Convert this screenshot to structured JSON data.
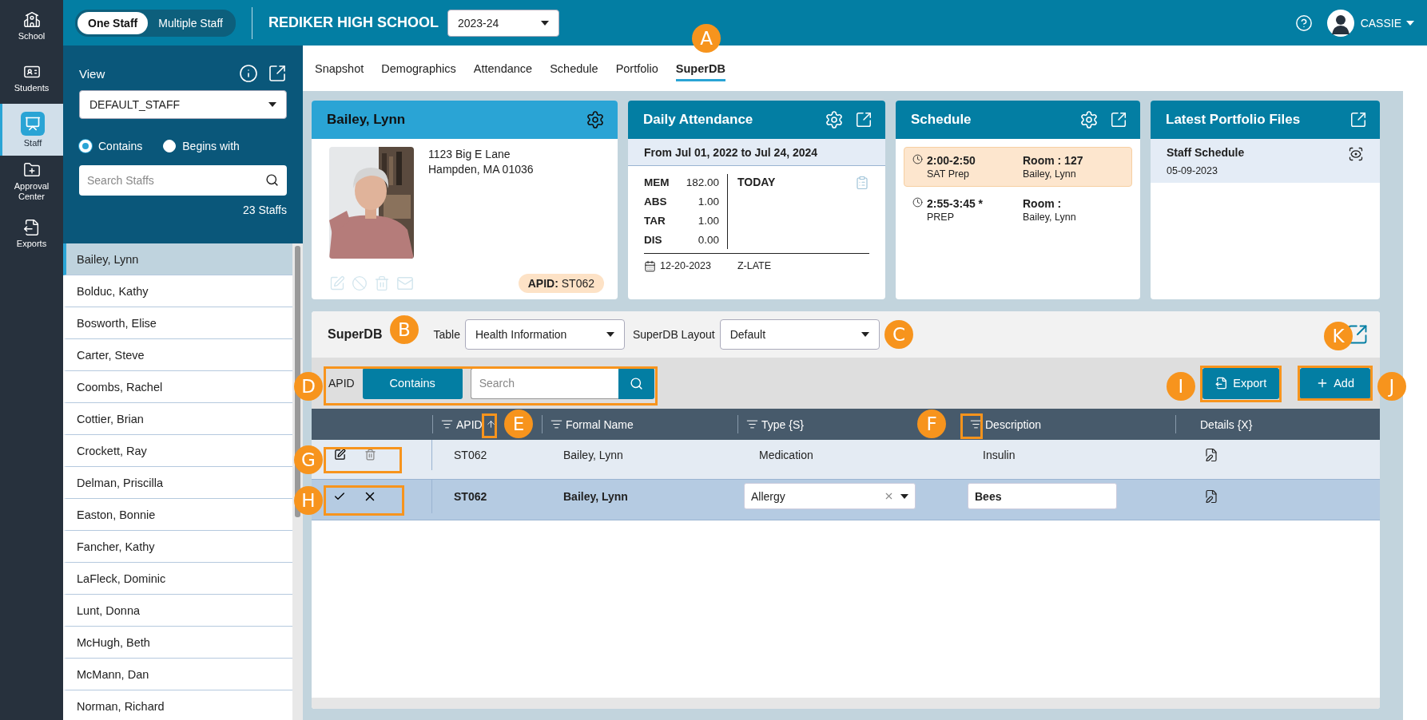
{
  "rail": [
    {
      "label": "School",
      "selected": false
    },
    {
      "label": "Students",
      "selected": false
    },
    {
      "label": "Staff",
      "selected": true
    },
    {
      "label": "Approval Center",
      "selected": false
    },
    {
      "label": "Exports",
      "selected": false
    }
  ],
  "topbar": {
    "modes": [
      {
        "label": "One Staff",
        "selected": true
      },
      {
        "label": "Multiple Staff",
        "selected": false
      }
    ],
    "school": "REDIKER HIGH SCHOOL",
    "year": "2023-24",
    "user": "CASSIE"
  },
  "side": {
    "view_label": "View",
    "view": "DEFAULT_STAFF",
    "match": [
      {
        "label": "Contains",
        "selected": true
      },
      {
        "label": "Begins with",
        "selected": false
      }
    ],
    "search_placeholder": "Search Staffs",
    "count": "23 Staffs",
    "staff": [
      {
        "name": "Bailey, Lynn",
        "selected": true
      },
      {
        "name": "Bolduc, Kathy",
        "selected": false
      },
      {
        "name": "Bosworth, Elise",
        "selected": false
      },
      {
        "name": "Carter, Steve",
        "selected": false
      },
      {
        "name": "Coombs, Rachel",
        "selected": false
      },
      {
        "name": "Cottier, Brian",
        "selected": false
      },
      {
        "name": "Crockett, Ray",
        "selected": false
      },
      {
        "name": "Delman, Priscilla",
        "selected": false
      },
      {
        "name": "Easton, Bonnie",
        "selected": false
      },
      {
        "name": "Fancher, Kathy",
        "selected": false
      },
      {
        "name": "LaFleck, Dominic",
        "selected": false
      },
      {
        "name": "Lunt, Donna",
        "selected": false
      },
      {
        "name": "McHugh, Beth",
        "selected": false
      },
      {
        "name": "McMann, Dan",
        "selected": false
      },
      {
        "name": "Norman, Richard",
        "selected": false
      }
    ]
  },
  "tabs": [
    {
      "label": "Snapshot",
      "selected": false
    },
    {
      "label": "Demographics",
      "selected": false
    },
    {
      "label": "Attendance",
      "selected": false
    },
    {
      "label": "Schedule",
      "selected": false
    },
    {
      "label": "Portfolio",
      "selected": false
    },
    {
      "label": "SuperDB",
      "selected": true
    }
  ],
  "profile": {
    "name": "Bailey, Lynn",
    "address": [
      "1123 Big E Lane",
      "Hampden, MA 01036"
    ],
    "apid_label": "APID:",
    "apid": "ST062"
  },
  "attendance": {
    "title": "Daily Attendance",
    "range": "From Jul 01, 2022 to Jul 24, 2024",
    "stats": [
      {
        "code": "MEM",
        "value": "182.00"
      },
      {
        "code": "ABS",
        "value": "1.00"
      },
      {
        "code": "TAR",
        "value": "1.00"
      },
      {
        "code": "DIS",
        "value": "0.00"
      }
    ],
    "today": "TODAY",
    "date": "12-20-2023",
    "code": "Z-LATE"
  },
  "schedule": {
    "title": "Schedule",
    "periods": [
      {
        "time": "2:00-2:50",
        "course": "SAT Prep",
        "room": "Room : 127",
        "teacher": "Bailey, Lynn",
        "selected": true
      },
      {
        "time": "2:55-3:45 *",
        "course": "PREP",
        "room": "Room :",
        "teacher": "Bailey, Lynn",
        "selected": false
      }
    ]
  },
  "portfolio": {
    "title": "Latest Portfolio Files",
    "files": [
      {
        "name": "Staff Schedule",
        "date": "05-09-2023"
      }
    ]
  },
  "superdb": {
    "title": "SuperDB",
    "table_label": "Table",
    "table": "Health Information",
    "layout_label": "SuperDB Layout",
    "layout": "Default",
    "filter_field": "APID",
    "filter_mode": "Contains",
    "search_placeholder": "Search",
    "export": "Export",
    "add": "Add",
    "columns": [
      {
        "label": "APID",
        "filter": true,
        "sorted": true
      },
      {
        "label": "Formal Name",
        "filter": true,
        "sorted": false
      },
      {
        "label": "Type {S}",
        "filter": true,
        "sorted": false
      },
      {
        "label": "Description",
        "filter": true,
        "sorted": false
      },
      {
        "label": "Details {X}",
        "filter": false,
        "sorted": false
      }
    ],
    "rows": [
      {
        "editing": false,
        "apid": "ST062",
        "name": "Bailey, Lynn",
        "type": "Medication",
        "description": "Insulin"
      },
      {
        "editing": true,
        "apid": "ST062",
        "name": "Bailey, Lynn",
        "type": "Allergy",
        "description": "Bees"
      }
    ]
  },
  "callouts": [
    {
      "letter": "A",
      "framed": false
    },
    {
      "letter": "B",
      "framed": false
    },
    {
      "letter": "C",
      "framed": false
    },
    {
      "letter": "D",
      "framed": true
    },
    {
      "letter": "E",
      "framed": true
    },
    {
      "letter": "F",
      "framed": true
    },
    {
      "letter": "G",
      "framed": true
    },
    {
      "letter": "H",
      "framed": true
    },
    {
      "letter": "I",
      "framed": true
    },
    {
      "letter": "J",
      "framed": true
    },
    {
      "letter": "K",
      "framed": false
    }
  ]
}
